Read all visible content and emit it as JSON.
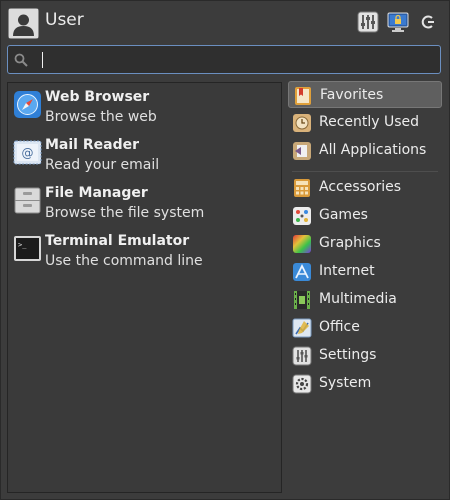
{
  "header": {
    "username": "User",
    "buttons": [
      {
        "icon": "settings-mixer-icon"
      },
      {
        "icon": "lock-screen-icon"
      },
      {
        "icon": "logout-icon"
      }
    ]
  },
  "search": {
    "placeholder": "",
    "value": ""
  },
  "favorites": [
    {
      "name": "Web Browser",
      "description": "Browse the web",
      "icon": "web-browser-icon"
    },
    {
      "name": "Mail Reader",
      "description": "Read your email",
      "icon": "mail-reader-icon"
    },
    {
      "name": "File Manager",
      "description": "Browse the file system",
      "icon": "file-manager-icon"
    },
    {
      "name": "Terminal Emulator",
      "description": "Use the command line",
      "icon": "terminal-icon"
    }
  ],
  "categories_top": [
    {
      "label": "Favorites",
      "selected": true,
      "icon": "favorites-icon"
    },
    {
      "label": "Recently Used",
      "selected": false,
      "icon": "recently-used-icon"
    },
    {
      "label": "All Applications",
      "selected": false,
      "icon": "all-applications-icon"
    }
  ],
  "categories": [
    {
      "label": "Accessories",
      "icon": "accessories-icon"
    },
    {
      "label": "Games",
      "icon": "games-icon"
    },
    {
      "label": "Graphics",
      "icon": "graphics-icon"
    },
    {
      "label": "Internet",
      "icon": "internet-icon"
    },
    {
      "label": "Multimedia",
      "icon": "multimedia-icon"
    },
    {
      "label": "Office",
      "icon": "office-icon"
    },
    {
      "label": "Settings",
      "icon": "settings-icon"
    },
    {
      "label": "System",
      "icon": "system-icon"
    }
  ],
  "colors": {
    "accent_border": "#6b8fc0",
    "selected_bg": "#5f5f5f",
    "panel_bg": "#3c3c3c"
  }
}
